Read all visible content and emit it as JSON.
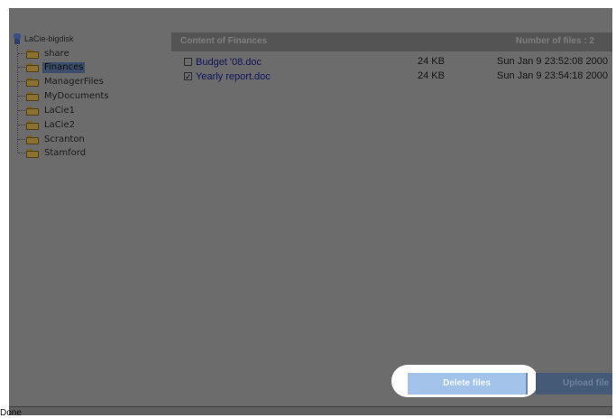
{
  "tree": {
    "root_label": "LaCie-bigdisk",
    "items": [
      {
        "label": "share",
        "selected": false
      },
      {
        "label": "Finances",
        "selected": true
      },
      {
        "label": "ManagerFiles",
        "selected": false
      },
      {
        "label": "MyDocuments",
        "selected": false
      },
      {
        "label": "LaCie1",
        "selected": false
      },
      {
        "label": "LaCie2",
        "selected": false
      },
      {
        "label": "Scranton",
        "selected": false
      },
      {
        "label": "Stamford",
        "selected": false
      }
    ]
  },
  "content": {
    "title": "Content of Finances",
    "count_label": "Number of files : 2",
    "files": [
      {
        "name": "Budget '08.doc",
        "size": "24 KB",
        "date": "Sun Jan 9 23:52:08 2000",
        "checked": false
      },
      {
        "name": "Yearly report.doc",
        "size": "24 KB",
        "date": "Sun Jan 9 23:54:18 2000",
        "checked": true
      }
    ]
  },
  "actions": {
    "delete_label": "Delete files",
    "upload_label": "Upload file"
  },
  "status": {
    "text": "Done"
  },
  "colors": {
    "overlay": "#6c6c6c",
    "delete_button": "#a3c3eb",
    "upload_button": "#455a77"
  }
}
